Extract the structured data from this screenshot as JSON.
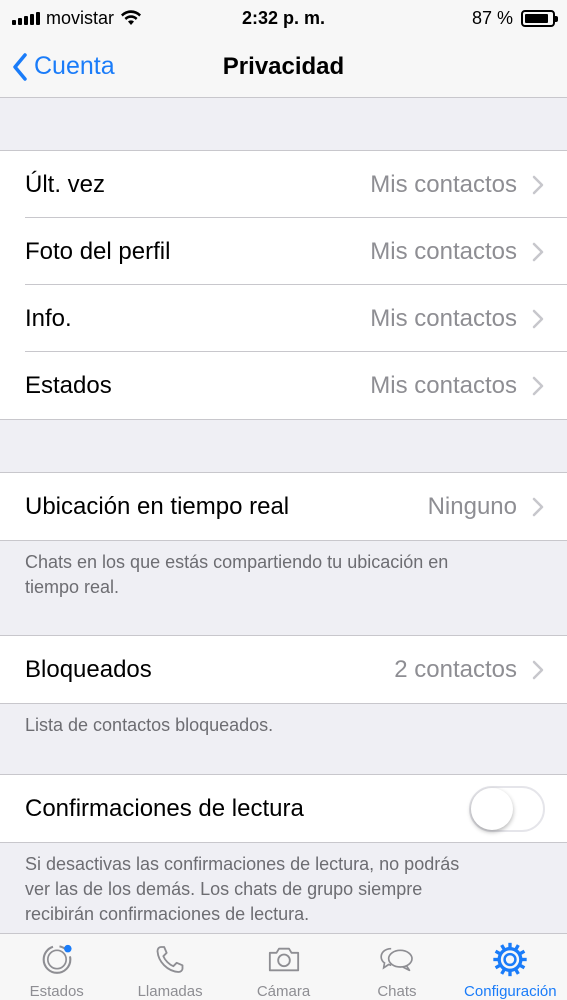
{
  "status_bar": {
    "carrier": "movistar",
    "time": "2:32 p. m.",
    "battery_percent": "87 %",
    "battery_level": 0.87
  },
  "nav": {
    "back_label": "Cuenta",
    "title": "Privacidad"
  },
  "group1": {
    "rows": [
      {
        "label": "Últ. vez",
        "value": "Mis contactos"
      },
      {
        "label": "Foto del perfil",
        "value": "Mis contactos"
      },
      {
        "label": "Info.",
        "value": "Mis contactos"
      },
      {
        "label": "Estados",
        "value": "Mis contactos"
      }
    ]
  },
  "live_location": {
    "label": "Ubicación en tiempo real",
    "value": "Ninguno",
    "footnote_line1": "Chats en los que estás compartiendo tu ubicación en",
    "footnote_line2": "tiempo real."
  },
  "blocked": {
    "label": "Bloqueados",
    "value": "2 contactos",
    "footnote": "Lista de contactos bloqueados."
  },
  "read_receipts": {
    "label": "Confirmaciones de lectura",
    "enabled": false,
    "footnote_line1": "Si desactivas las confirmaciones de lectura, no podrás",
    "footnote_line2": "ver las de los demás. Los chats de grupo siempre",
    "footnote_line3": "recibirán confirmaciones de lectura."
  },
  "tabs": [
    {
      "label": "Estados",
      "icon": "status-icon"
    },
    {
      "label": "Llamadas",
      "icon": "phone-icon"
    },
    {
      "label": "Cámara",
      "icon": "camera-icon"
    },
    {
      "label": "Chats",
      "icon": "chats-icon"
    },
    {
      "label": "Configuración",
      "icon": "gear-icon",
      "active": true
    }
  ],
  "colors": {
    "accent": "#1a7cf9",
    "background": "#efeff4",
    "secondary_text": "#8e8e93"
  }
}
